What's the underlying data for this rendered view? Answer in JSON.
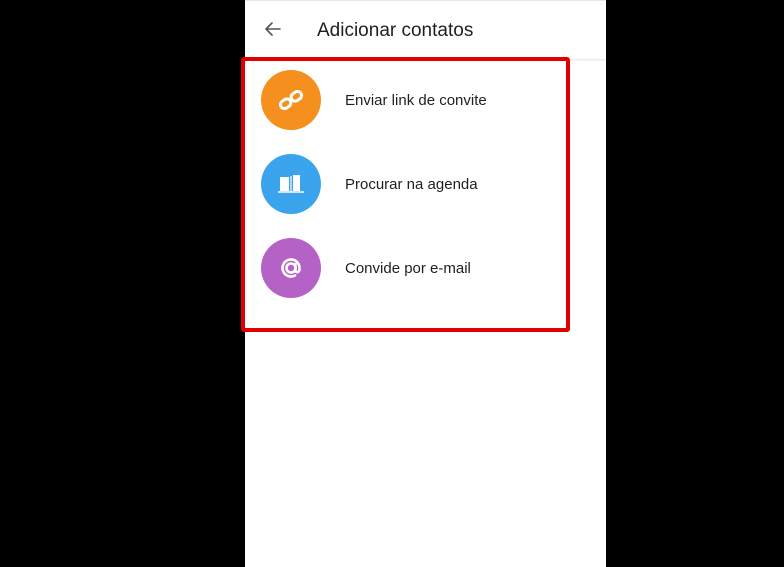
{
  "header": {
    "title": "Adicionar contatos",
    "back_icon": "arrow-left-icon"
  },
  "options": [
    {
      "label": "Enviar link de convite",
      "icon": "link-icon",
      "color": "#f5901e"
    },
    {
      "label": "Procurar na agenda",
      "icon": "book-icon",
      "color": "#3aa5ec"
    },
    {
      "label": "Convide por e-mail",
      "icon": "at-sign-icon",
      "color": "#b562c6"
    }
  ],
  "colors": {
    "highlight": "#e00000",
    "background": "#000000",
    "surface": "#ffffff"
  }
}
